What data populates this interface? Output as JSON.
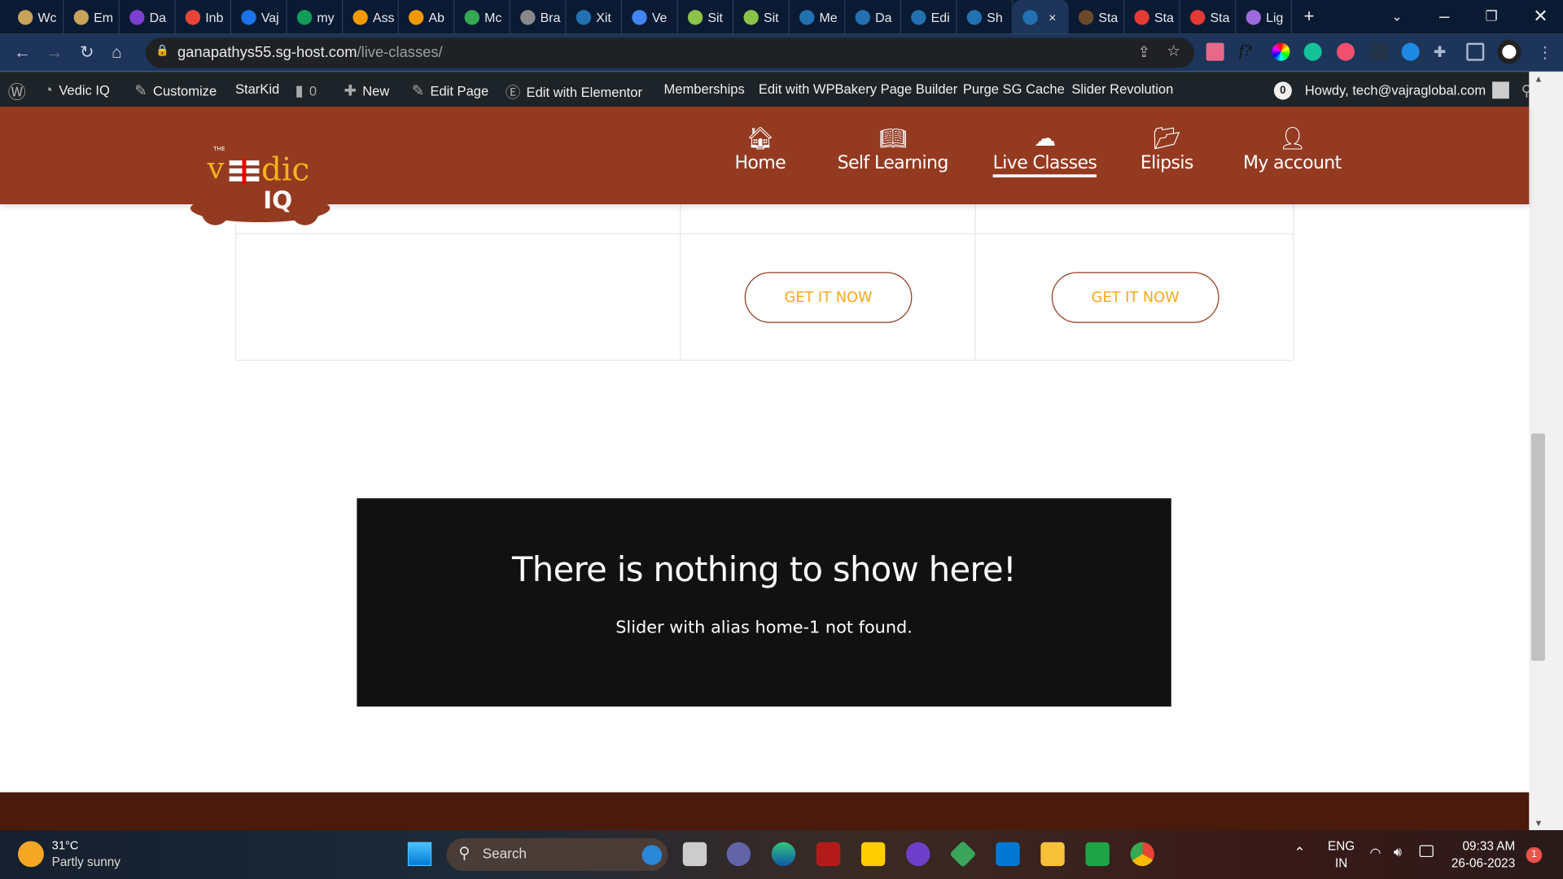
{
  "browser": {
    "tabs": [
      {
        "label": "Wc",
        "color": "#c8a35a"
      },
      {
        "label": "Em",
        "color": "#c8a35a"
      },
      {
        "label": "Da",
        "color": "#7b3fd1"
      },
      {
        "label": "Inb",
        "color": "#ea4335"
      },
      {
        "label": "Vaj",
        "color": "#1a73e8"
      },
      {
        "label": "my",
        "color": "#0f9d58"
      },
      {
        "label": "Ass",
        "color": "#f29900"
      },
      {
        "label": "Ab",
        "color": "#f29900"
      },
      {
        "label": "Mc",
        "color": "#34a853"
      },
      {
        "label": "Bra",
        "color": "#888"
      },
      {
        "label": "Xit",
        "color": "#2271b1"
      },
      {
        "label": "Ve",
        "color": "#4285f4"
      },
      {
        "label": "Sit",
        "color": "#8bc34a"
      },
      {
        "label": "Sit",
        "color": "#8bc34a"
      },
      {
        "label": "Me",
        "color": "#2271b1"
      },
      {
        "label": "Da",
        "color": "#2271b1"
      },
      {
        "label": "Edi",
        "color": "#2271b1"
      },
      {
        "label": "Sh",
        "color": "#2271b1"
      },
      {
        "label": "",
        "color": "#2271b1",
        "active": true
      },
      {
        "label": "Sta",
        "color": "#6b4a2a"
      },
      {
        "label": "Sta",
        "color": "#e53935"
      },
      {
        "label": "Sta",
        "color": "#e53935"
      },
      {
        "label": "Lig",
        "color": "#9c6ade"
      }
    ],
    "close_tab": "×",
    "new_tab": "+",
    "url_host": "ganapathys55.sg-host.com",
    "url_path": "/live-classes/"
  },
  "wp_admin_bar": {
    "site_name": "Vedic IQ",
    "customize": "Customize",
    "starkid": "StarKid",
    "comments_count": "0",
    "new": "New",
    "edit_page": "Edit Page",
    "edit_elementor": "Edit with Elementor",
    "memberships": "Memberships",
    "edit_wpbakery": "Edit with WPBakery Page Builder",
    "purge_cache": "Purge SG Cache",
    "slider_revolution": "Slider Revolution",
    "notif_count": "0",
    "howdy": "Howdy, tech@vajraglobal.com"
  },
  "site": {
    "logo_text": "THE VEdic IQ",
    "menu": [
      {
        "label": "Home",
        "icon": "home-icon"
      },
      {
        "label": "Self Learning",
        "icon": "book-icon"
      },
      {
        "label": "Live Classes",
        "icon": "cloud-icon",
        "active": true
      },
      {
        "label": "Elipsis",
        "icon": "folder-icon"
      },
      {
        "label": "My account",
        "icon": "user-icon"
      }
    ],
    "buttons": [
      "GET IT NOW",
      "GET IT NOW"
    ],
    "slider_title": "There is nothing to show here!",
    "slider_message": "Slider with alias home-1 not found.",
    "brand_color": "#943a21",
    "button_text_color": "#f5a81c"
  },
  "taskbar": {
    "temperature": "31°C",
    "weather": "Partly sunny",
    "search": "Search",
    "lang": "ENG",
    "region": "IN",
    "time": "09:33 AM",
    "date": "26-06-2023",
    "notifications": "1"
  }
}
